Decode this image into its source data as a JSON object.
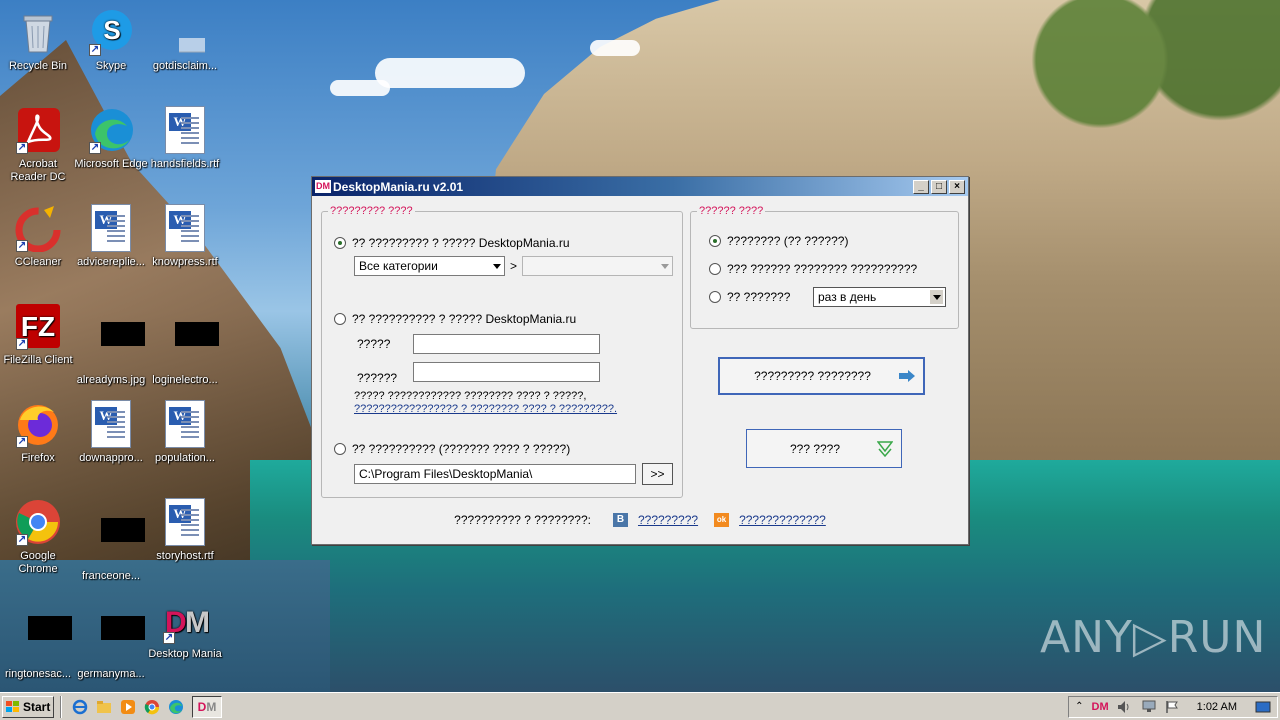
{
  "desktop": {
    "icons": [
      {
        "label": "Recycle Bin"
      },
      {
        "label": "Skype"
      },
      {
        "label": "gotdisclaim..."
      },
      {
        "label": "Acrobat Reader DC"
      },
      {
        "label": "Microsoft Edge"
      },
      {
        "label": "handsfields.rtf"
      },
      {
        "label": "CCleaner"
      },
      {
        "label": "advicereplie..."
      },
      {
        "label": "knowpress.rtf"
      },
      {
        "label": "FileZilla Client"
      },
      {
        "label": "alreadyms.jpg"
      },
      {
        "label": "loginelectro..."
      },
      {
        "label": "Firefox"
      },
      {
        "label": "downappro..."
      },
      {
        "label": "population..."
      },
      {
        "label": "Google Chrome"
      },
      {
        "label": "franceone..."
      },
      {
        "label": "storyhost.rtf"
      },
      {
        "label": "ringtonesac..."
      },
      {
        "label": "germanyma..."
      },
      {
        "label": "Desktop Mania"
      }
    ],
    "watermark": "ANY▷RUN"
  },
  "window": {
    "title": "DesktopMania.ru v2.01",
    "logo": "DM",
    "controls": {
      "minimize": "_",
      "maximize": "□",
      "close": "×"
    },
    "source_group": {
      "legend": "????????? ????",
      "option1": "?? ????????? ? ????? DesktopMania.ru",
      "category_select": "Все категории",
      "category_separator": ">",
      "subcategory_select": "",
      "option2": "?? ?????????? ? ????? DesktopMania.ru",
      "login_label": "?????",
      "password_label": "??????",
      "login_value": "",
      "password_value": "",
      "register_note": "????? ???????????? ???????? ???? ? ?????,",
      "register_link": "????????????????? ? ???????? ???? ? ?????????.",
      "option3": "?? ?????????? (??????? ???? ? ?????)",
      "folder_path": "C:\\Program Files\\DesktopMania\\",
      "browse_button": ">>"
    },
    "change_group": {
      "legend": "?????? ????",
      "option1": "???????? (?? ??????)",
      "option2": "??? ?????? ???????? ??????????",
      "option3": "?? ???????",
      "interval_select": "раз в день"
    },
    "buttons": {
      "primary": "????????? ????????",
      "secondary": "??? ????"
    },
    "footer": {
      "text": "?????????? ? ????????:",
      "vk_icon": "B",
      "vk_link": "?????????",
      "ok_icon": "ok",
      "ok_link": "?????????????"
    }
  },
  "taskbar": {
    "start_label": "Start",
    "tray_dm": "DM",
    "clock": "1:02 AM"
  }
}
